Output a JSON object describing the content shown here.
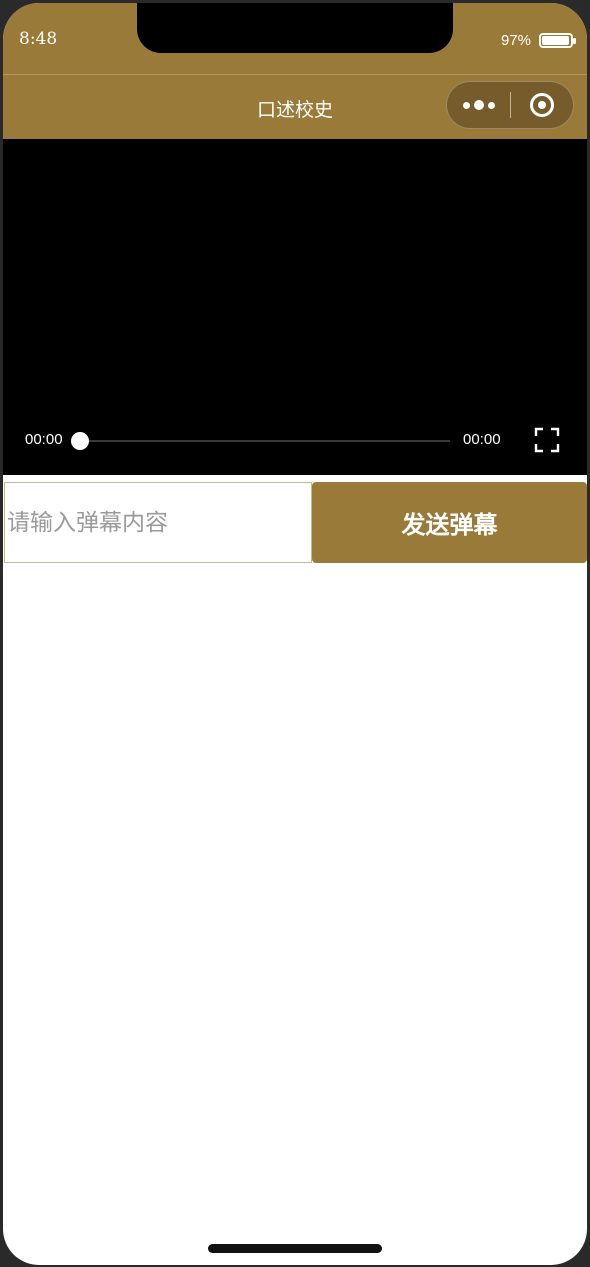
{
  "status_bar": {
    "time": "8:48",
    "battery_percent": "97%",
    "battery_level": 0.97
  },
  "nav": {
    "title": "口述校史",
    "more_icon": "more-dots-icon",
    "close_icon": "capsule-close-icon"
  },
  "video": {
    "current_time": "00:00",
    "duration": "00:00",
    "progress": 0,
    "fullscreen_icon": "fullscreen-icon"
  },
  "danmu": {
    "placeholder": "请输入弹幕内容",
    "value": "",
    "send_label": "发送弹幕"
  },
  "colors": {
    "brand": "#9a7a38",
    "video_bg": "#000000",
    "page_bg": "#ffffff"
  }
}
